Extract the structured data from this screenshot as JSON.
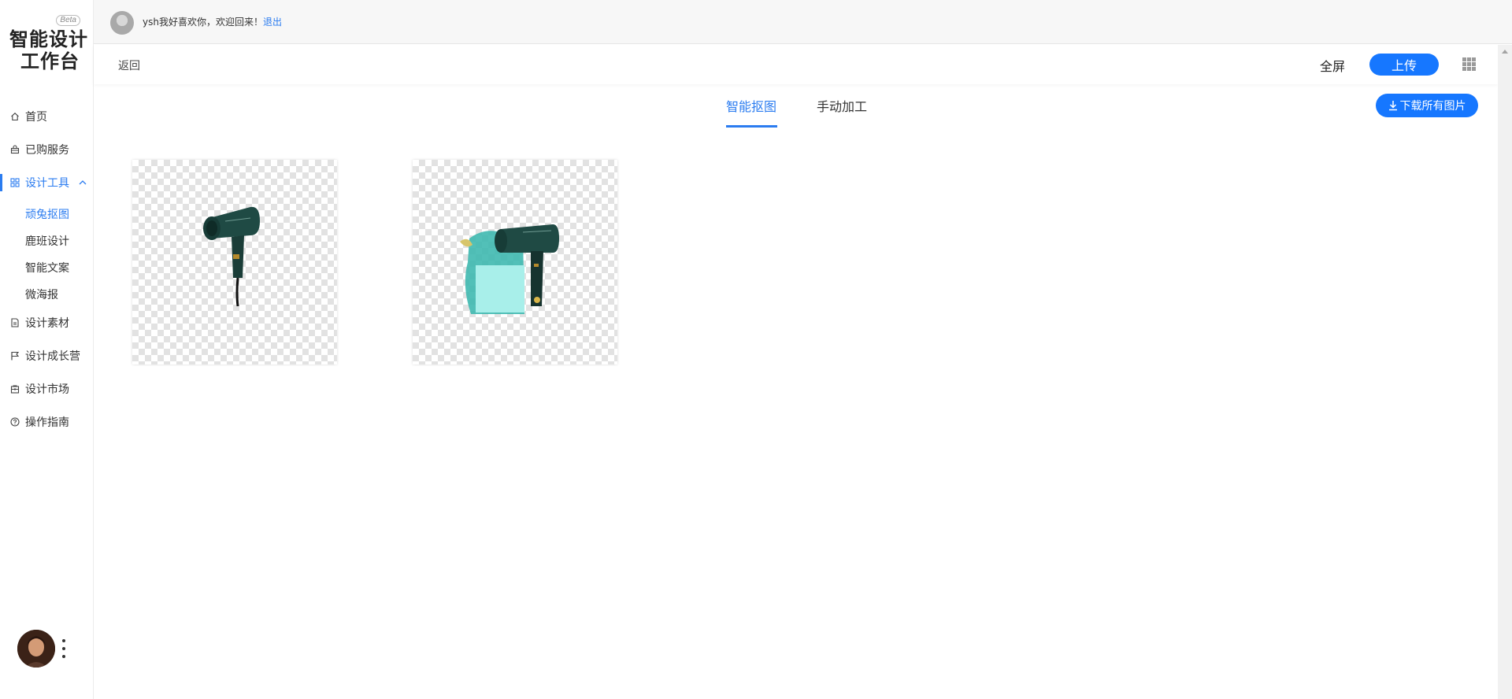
{
  "app": {
    "logo_line1": "智能设计",
    "logo_line2": "工作台",
    "beta_badge": "Beta"
  },
  "sidebar": {
    "items": [
      {
        "label": "首页",
        "icon": "home-icon"
      },
      {
        "label": "已购服务",
        "icon": "bag-icon"
      },
      {
        "label": "设计工具",
        "icon": "grid-apps-icon",
        "expanded": true
      },
      {
        "label": "设计素材",
        "icon": "document-icon"
      },
      {
        "label": "设计成长营",
        "icon": "flag-icon"
      },
      {
        "label": "设计市场",
        "icon": "shop-icon"
      },
      {
        "label": "操作指南",
        "icon": "help-circle-icon"
      }
    ],
    "sub_items": [
      {
        "label": "顽兔抠图",
        "active": true
      },
      {
        "label": "鹿班设计"
      },
      {
        "label": "智能文案"
      },
      {
        "label": "微海报"
      }
    ]
  },
  "header": {
    "welcome": "ysh我好喜欢你，欢迎回来！",
    "logout": "退出"
  },
  "toolbar": {
    "back": "返回",
    "fullscreen": "全屏",
    "upload": "上传"
  },
  "tabs": [
    {
      "label": "智能抠图",
      "active": true
    },
    {
      "label": "手动加工",
      "active": false
    }
  ],
  "download_all": "下载所有图片",
  "images": [
    {
      "name": "hair-dryer-cutout",
      "icon": "hair-dryer-image"
    },
    {
      "name": "hair-dryer-with-scene-cutout",
      "icon": "hair-dryer-scene-image"
    }
  ],
  "colors": {
    "accent": "#2b7cf0",
    "button": "#1677ff",
    "product": "#1f4a44"
  }
}
